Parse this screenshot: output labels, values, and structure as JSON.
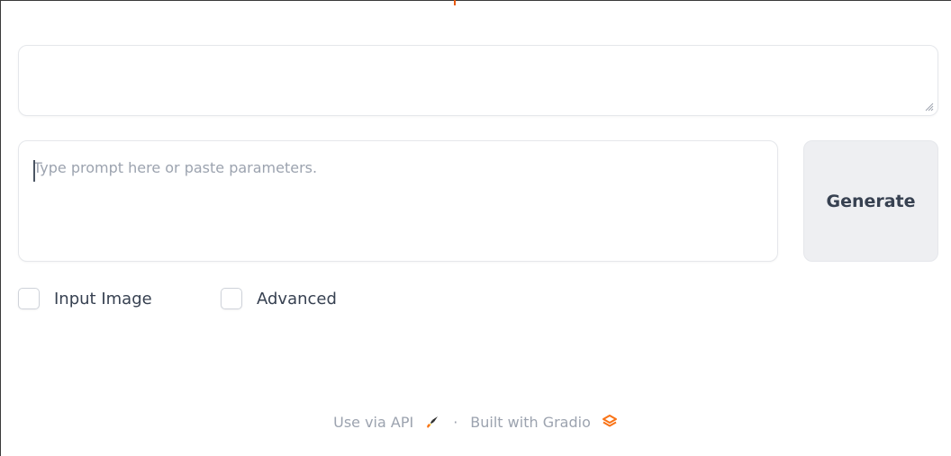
{
  "output": {
    "value": ""
  },
  "prompt": {
    "value": "",
    "placeholder": "Type prompt here or paste parameters."
  },
  "generate": {
    "label": "Generate"
  },
  "options": {
    "input_image_label": "Input Image",
    "input_image_checked": false,
    "advanced_label": "Advanced",
    "advanced_checked": false
  },
  "footer": {
    "api_label": "Use via API",
    "separator": "·",
    "built_with_label": "Built with Gradio",
    "api_icon": "rocket-icon",
    "gradio_icon": "gradio-logo-icon"
  },
  "colors": {
    "accent": "#f97316",
    "button_bg": "#eeeff2",
    "border": "#e5e7eb",
    "muted_text": "#9ca3af"
  }
}
